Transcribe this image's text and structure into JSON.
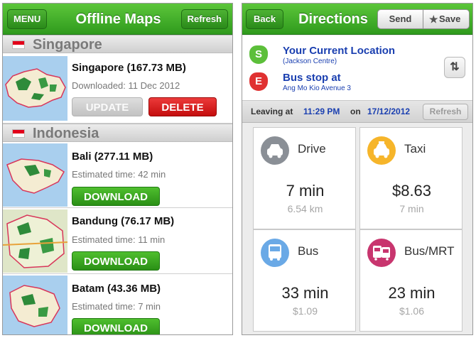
{
  "left": {
    "nav": {
      "menu_label": "MENU",
      "title": "Offline Maps",
      "refresh_label": "Refresh"
    },
    "sections": [
      {
        "name": "Singapore",
        "items": [
          {
            "name": "Singapore (167.73 MB)",
            "detail": "Downloaded: 11 Dec 2012",
            "update_label": "UPDATE",
            "delete_label": "DELETE"
          }
        ]
      },
      {
        "name": "Indonesia",
        "items": [
          {
            "name": "Bali (277.11 MB)",
            "detail": "Estimated time: 42 min",
            "button_label": "DOWNLOAD"
          },
          {
            "name": "Bandung (76.17 MB)",
            "detail": "Estimated time: 11 min",
            "button_label": "DOWNLOAD"
          },
          {
            "name": "Batam (43.36 MB)",
            "detail": "Estimated time: 7 min",
            "button_label": "DOWNLOAD"
          }
        ]
      }
    ]
  },
  "right": {
    "nav": {
      "back_label": "Back",
      "title": "Directions",
      "send_label": "Send",
      "save_label": "Save"
    },
    "start": {
      "marker": "S",
      "title": "Your Current Location",
      "sub": "(Jackson Centre)"
    },
    "end": {
      "marker": "E",
      "title": "Bus stop at",
      "sub": "Ang Mo Kio Avenue 3"
    },
    "leaving": {
      "label": "Leaving at",
      "time": "11:29 PM",
      "on_label": "on",
      "date": "17/12/2012",
      "refresh_label": "Refresh"
    },
    "options": [
      {
        "label": "Drive",
        "value": "7 min",
        "sub": "6.54 km",
        "icon": "car-icon",
        "color": "#8a8f96"
      },
      {
        "label": "Taxi",
        "value": "$8.63",
        "sub": "7 min",
        "icon": "taxi-icon",
        "color": "#f6b52a"
      },
      {
        "label": "Bus",
        "value": "33 min",
        "sub": "$1.09",
        "icon": "bus-icon",
        "color": "#6aa9e6"
      },
      {
        "label": "Bus/MRT",
        "value": "23 min",
        "sub": "$1.06",
        "icon": "train-icon",
        "color": "#c8356e"
      }
    ]
  },
  "colors": {
    "nav_green": "#3aa624",
    "delete_red": "#d42020",
    "link_blue": "#1a3fb0"
  }
}
